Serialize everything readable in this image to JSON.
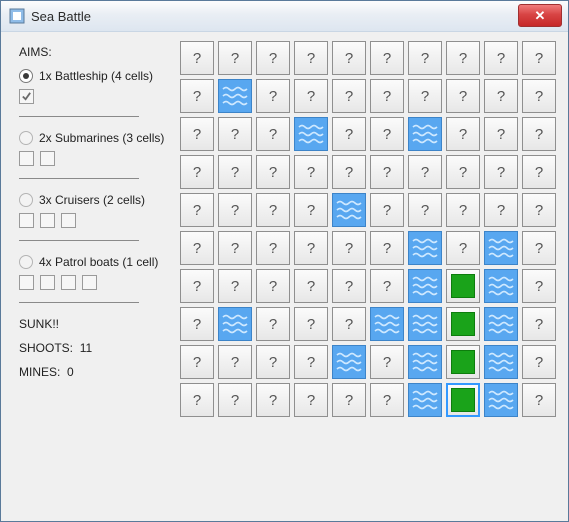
{
  "window": {
    "title": "Sea Battle",
    "close_label": "✕"
  },
  "sidebar": {
    "aims_label": "AIMS:",
    "aims": [
      {
        "id": "battleship",
        "label": "1x Battleship (4 cells)",
        "selected": true,
        "slots": 1,
        "checked": [
          true
        ]
      },
      {
        "id": "submarines",
        "label": "2x Submarines (3 cells)",
        "selected": false,
        "slots": 2,
        "checked": [
          false,
          false
        ]
      },
      {
        "id": "cruisers",
        "label": "3x Cruisers (2 cells)",
        "selected": false,
        "slots": 3,
        "checked": [
          false,
          false,
          false
        ]
      },
      {
        "id": "patrolboats",
        "label": "4x Patrol boats (1 cell)",
        "selected": false,
        "slots": 4,
        "checked": [
          false,
          false,
          false,
          false
        ]
      }
    ],
    "sunk_label": "SUNK!!",
    "shoots_label": "SHOOTS:",
    "shoots_value": "11",
    "mines_label": "MINES:",
    "mines_value": "0"
  },
  "grid": {
    "rows": 10,
    "cols": 10,
    "unknown_glyph": "?",
    "cells": [
      [
        "?",
        "?",
        "?",
        "?",
        "?",
        "?",
        "?",
        "?",
        "?",
        "?"
      ],
      [
        "?",
        "W",
        "?",
        "?",
        "?",
        "?",
        "?",
        "?",
        "?",
        "?"
      ],
      [
        "?",
        "?",
        "?",
        "W",
        "?",
        "?",
        "W",
        "?",
        "?",
        "?"
      ],
      [
        "?",
        "?",
        "?",
        "?",
        "?",
        "?",
        "?",
        "?",
        "?",
        "?"
      ],
      [
        "?",
        "?",
        "?",
        "?",
        "W",
        "?",
        "?",
        "?",
        "?",
        "?"
      ],
      [
        "?",
        "?",
        "?",
        "?",
        "?",
        "?",
        "W",
        "?",
        "W",
        "?"
      ],
      [
        "?",
        "?",
        "?",
        "?",
        "?",
        "?",
        "W",
        "H",
        "W",
        "?"
      ],
      [
        "?",
        "W",
        "?",
        "?",
        "?",
        "W",
        "W",
        "H",
        "W",
        "?"
      ],
      [
        "?",
        "?",
        "?",
        "?",
        "W",
        "?",
        "W",
        "H",
        "W",
        "?"
      ],
      [
        "?",
        "?",
        "?",
        "?",
        "?",
        "?",
        "W",
        "H",
        "W",
        "?"
      ]
    ],
    "selected": {
      "row": 9,
      "col": 7
    }
  }
}
